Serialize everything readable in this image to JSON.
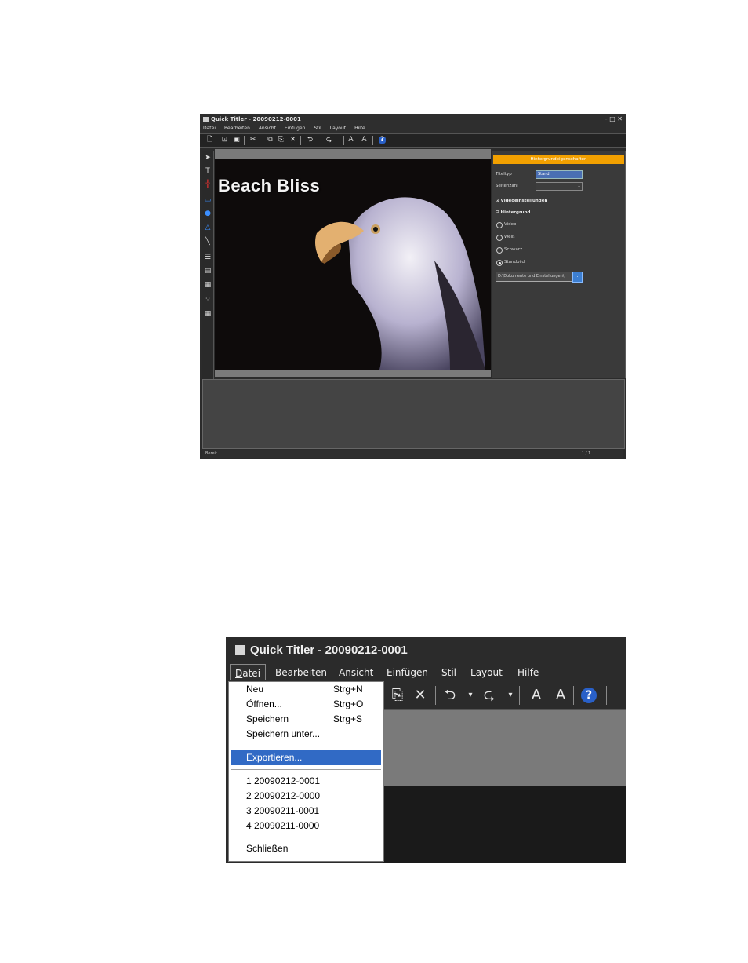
{
  "screenshot1": {
    "title": "Quick Titler - 20090212-0001",
    "window_controls": [
      "–",
      "□",
      "✕"
    ],
    "menu": [
      "Datei",
      "Bearbeiten",
      "Ansicht",
      "Einfügen",
      "Stil",
      "Layout",
      "Hilfe"
    ],
    "canvas_title": "Beach Bliss",
    "panel": {
      "header": "Hintergrundeigenschaften",
      "titletyp_label": "Titeltyp",
      "titletyp_value": "Stand",
      "seitenzahl_label": "Seitenzahl",
      "seitenzahl_value": "1",
      "videoeinstellungen": "Videoeinstellungen",
      "hintergrund": "Hintergrund",
      "options": [
        "Video",
        "Weiß",
        "Schwarz",
        "Standbild"
      ],
      "selected_option": "Standbild",
      "path": "D:\\Dokumente und Einstellungen\\"
    },
    "status_left": "Bereit",
    "status_right": "1 / 1"
  },
  "screenshot2": {
    "title": "Quick Titler - 20090212-0001",
    "menu": [
      {
        "label": "Datei",
        "key": "D",
        "rest": "atei"
      },
      {
        "label": "Bearbeiten",
        "key": "B",
        "rest": "earbeiten"
      },
      {
        "label": "Ansicht",
        "key": "A",
        "rest": "nsicht"
      },
      {
        "label": "Einfügen",
        "key": "E",
        "rest": "infügen"
      },
      {
        "label": "Stil",
        "key": "S",
        "rest": "til"
      },
      {
        "label": "Layout",
        "key": "L",
        "rest": "ayout"
      },
      {
        "label": "Hilfe",
        "key": "H",
        "rest": "ilfe"
      }
    ],
    "dropdown": {
      "neu": "Neu",
      "neu_sc": "Strg+N",
      "oeffnen": "Öffnen...",
      "oeffnen_sc": "Strg+O",
      "speichern": "Speichern",
      "speichern_sc": "Strg+S",
      "speichern_unter": "Speichern unter...",
      "exportieren": "Exportieren...",
      "recent1": "1 20090212-0001",
      "recent2": "2 20090212-0000",
      "recent3": "3 20090211-0001",
      "recent4": "4 20090211-0000",
      "schliessen": "Schließen"
    }
  },
  "colors": {
    "panel_header": "#f2a000",
    "menu_highlight": "#316ac5",
    "window_bg": "#2b2b2b"
  }
}
